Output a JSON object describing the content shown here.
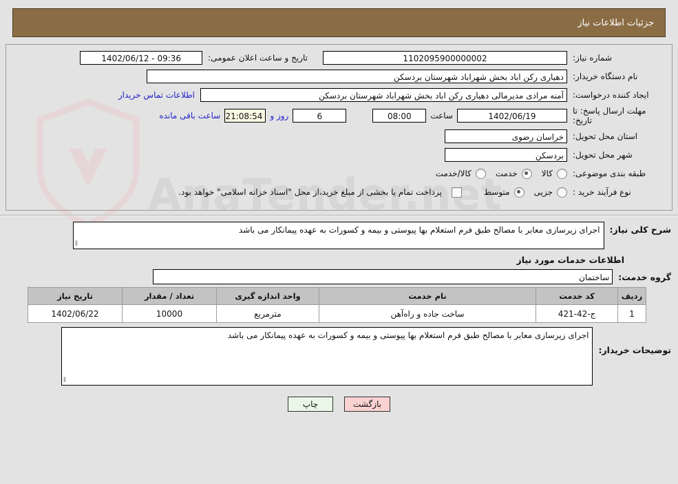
{
  "header": {
    "title": "جزئیات اطلاعات نیاز"
  },
  "watermark": {
    "text": "AnaTender.net"
  },
  "form": {
    "need_number_label": "شماره نیاز:",
    "need_number_value": "1102095900000002",
    "public_announce_label": "تاریخ و ساعت اعلان عمومی:",
    "public_announce_value": "09:36 - 1402/06/12",
    "buyer_org_label": "نام دستگاه خریدار:",
    "buyer_org_value": "دهیاری رکن اباد بخش شهراباد شهرستان بردسکن",
    "requester_label": "ایجاد کننده درخواست:",
    "requester_value": "آمنه مرادی مدیرمالی دهیاری رکن اباد بخش شهراباد شهرستان بردسکن",
    "contact_link": "اطلاعات تماس خریدار",
    "deadline_label": "مهلت ارسال پاسخ: تا تاریخ:",
    "deadline_date": "1402/06/19",
    "hour_label": "ساعت",
    "deadline_time": "08:00",
    "days_value": "6",
    "days_label": "روز و",
    "remaining_time": "21:08:54",
    "remaining_label": "ساعت باقی مانده",
    "province_label": "استان محل تحویل:",
    "province_value": "خراسان رضوی",
    "city_label": "شهر محل تحویل:",
    "city_value": "بردسکن",
    "category_label": "طبقه بندی موضوعی:",
    "category_options": [
      "کالا",
      "خدمت",
      "کالا/خدمت"
    ],
    "category_selected": "خدمت",
    "process_label": "نوع فرآیند خرید :",
    "process_options": [
      "جزیی",
      "متوسط"
    ],
    "process_selected": "متوسط",
    "treasury_note": "پرداخت تمام یا بخشی از مبلغ خرید،از محل \"اسناد خزانه اسلامی\" خواهد بود."
  },
  "description": {
    "label": "شرح کلی نیاز:",
    "value": "اجرای زیرسازی معابر با مصالح طبق فرم استعلام بها پیوستی و بیمه و کسورات به عهده پیمانکار می باشد"
  },
  "services_section": {
    "title": "اطلاعات خدمات مورد نیاز",
    "group_label": "گروه خدمت:",
    "group_value": "ساختمان"
  },
  "table": {
    "columns": [
      "ردیف",
      "کد خدمت",
      "نام خدمت",
      "واحد اندازه گیری",
      "تعداد / مقدار",
      "تاریخ نیاز"
    ],
    "rows": [
      {
        "index": "1",
        "code": "ج-42-421",
        "name": "ساخت جاده و راه‌آهن",
        "unit": "مترمربع",
        "quantity": "10000",
        "need_date": "1402/06/22"
      }
    ]
  },
  "buyer_notes": {
    "label": "توضیحات خریدار:",
    "value": "اجرای زیرسازی معابر با مصالح طبق فرم استعلام بها پیوستی و بیمه و کسورات به عهده پیمانکار می باشد"
  },
  "buttons": {
    "back": "بازگشت",
    "print": "چاپ"
  }
}
